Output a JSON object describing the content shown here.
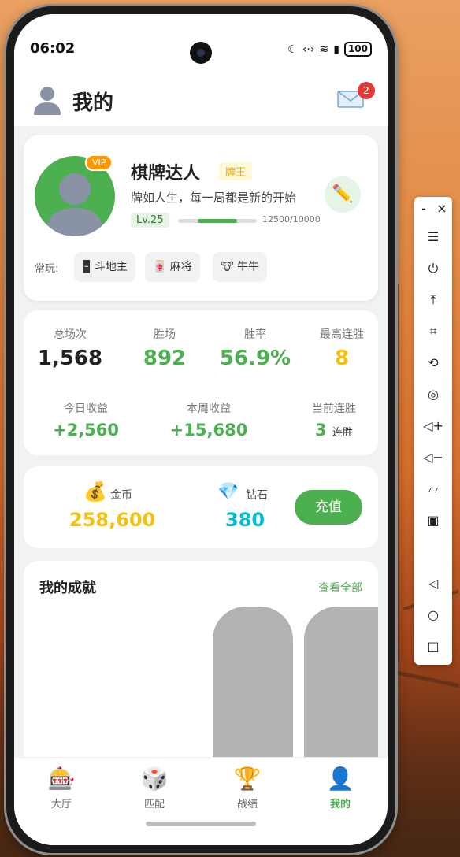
{
  "status_bar": {
    "time": "06:02",
    "battery": "100"
  },
  "header": {
    "title": "我的",
    "mail_badge": "2"
  },
  "profile": {
    "vip": "VIP",
    "name": "棋牌达人",
    "tag": "牌王",
    "motto": "牌如人生，每一局都是新的开始",
    "level": "Lv.25",
    "exp_text": "12500/10000",
    "edit_icon": "pencil-icon",
    "favorites_label": "常玩:",
    "favorites": [
      {
        "icon": "🁢",
        "label": "斗地主"
      },
      {
        "icon": "🀄",
        "label": "麻将"
      },
      {
        "icon": "🐮",
        "label": "牛牛"
      }
    ]
  },
  "stats": {
    "total_games": {
      "label": "总场次",
      "value": "1,568"
    },
    "wins": {
      "label": "胜场",
      "value": "892"
    },
    "win_rate": {
      "label": "胜率",
      "value": "56.9%"
    },
    "max_streak": {
      "label": "最高连胜",
      "value": "8"
    },
    "today_income": {
      "label": "今日收益",
      "value": "+2,560"
    },
    "week_income": {
      "label": "本周收益",
      "value": "+15,680"
    },
    "current_streak": {
      "label": "当前连胜",
      "value": "3",
      "unit": "连胜"
    }
  },
  "wallet": {
    "gold": {
      "icon": "💰",
      "label": "金币",
      "value": "258,600"
    },
    "diamond": {
      "icon": "💎",
      "label": "钻石",
      "value": "380"
    },
    "recharge_label": "充值"
  },
  "achievements": {
    "title": "我的成就",
    "view_all": "查看全部"
  },
  "tabs": [
    {
      "icon": "🎰",
      "label": "大厅"
    },
    {
      "icon": "🎲",
      "label": "匹配"
    },
    {
      "icon": "🏆",
      "label": "战绩"
    },
    {
      "icon": "👤",
      "label": "我的",
      "active": true
    }
  ],
  "side_toolbar": {
    "minimize": "-",
    "close": "×",
    "items": [
      "menu-icon",
      "power-icon",
      "pin-top-icon",
      "crop-icon",
      "rotate-icon",
      "screenshot-icon",
      "volume-up-icon",
      "volume-down-icon",
      "shake-icon",
      "devices-icon",
      "back-icon",
      "home-icon",
      "recents-icon"
    ]
  },
  "colors": {
    "accent": "#4caf50",
    "gold": "#f4c20d",
    "diamond": "#00bcd4",
    "badge": "#e53935",
    "vip": "#ff9800"
  }
}
